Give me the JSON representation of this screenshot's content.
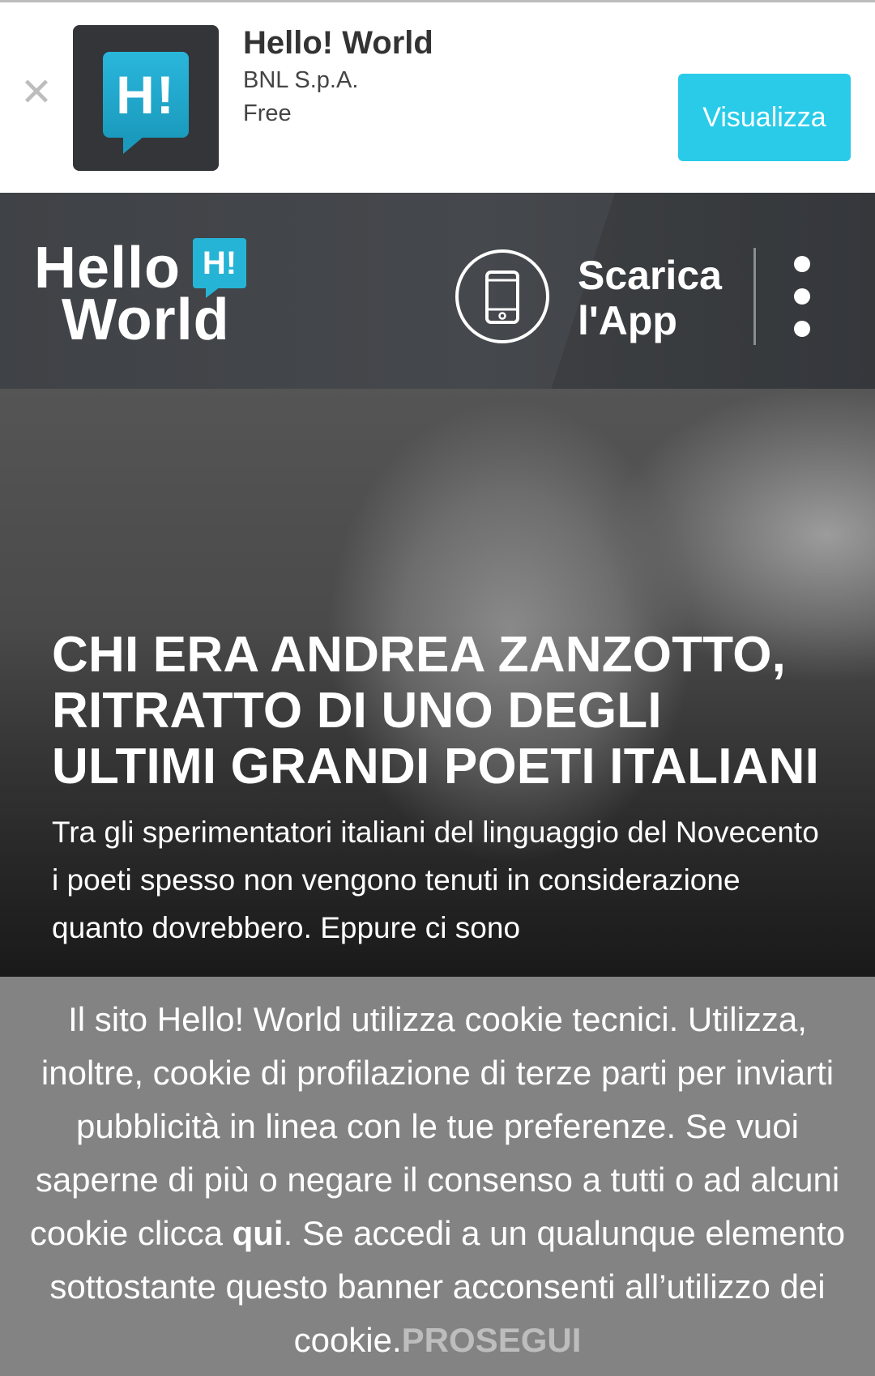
{
  "app_banner": {
    "close_icon": "close-icon",
    "icon_text": "H!",
    "app_name": "Hello! World",
    "publisher": "BNL S.p.A.",
    "price": "Free",
    "button_label": "Visualizza",
    "accent_color": "#29cbe9"
  },
  "header": {
    "logo_line1": "Hello",
    "logo_line2": "World",
    "logo_badge": "H!",
    "phone_icon": "smartphone-icon",
    "download_label": "Scarica\nl'App",
    "menu_icon": "more-vertical-icon"
  },
  "article": {
    "title": "CHI ERA ANDREA ZANZOTTO, RITRATTO DI UNO DEGLI ULTIMI GRANDI POETI ITALIANI",
    "excerpt": "Tra gli sperimentatori italiani del linguaggio del Novecento i poeti spesso non vengono tenuti in considerazione quanto dovrebbero. Eppure ci sono"
  },
  "cookie": {
    "text_before_link": "Il sito Hello! World utilizza cookie tecnici. Utilizza, inoltre, cookie di profilazione di terze parti per inviarti pubblicità in linea con le tue preferenze. Se vuoi saperne di più o negare il consenso a tutti o ad alcuni cookie clicca ",
    "link_label": "qui",
    "text_after_link": ". Se accedi a un qualunque elemento sottostante questo banner acconsenti all’utilizzo dei cookie.",
    "accept_label": "PROSEGUI"
  }
}
